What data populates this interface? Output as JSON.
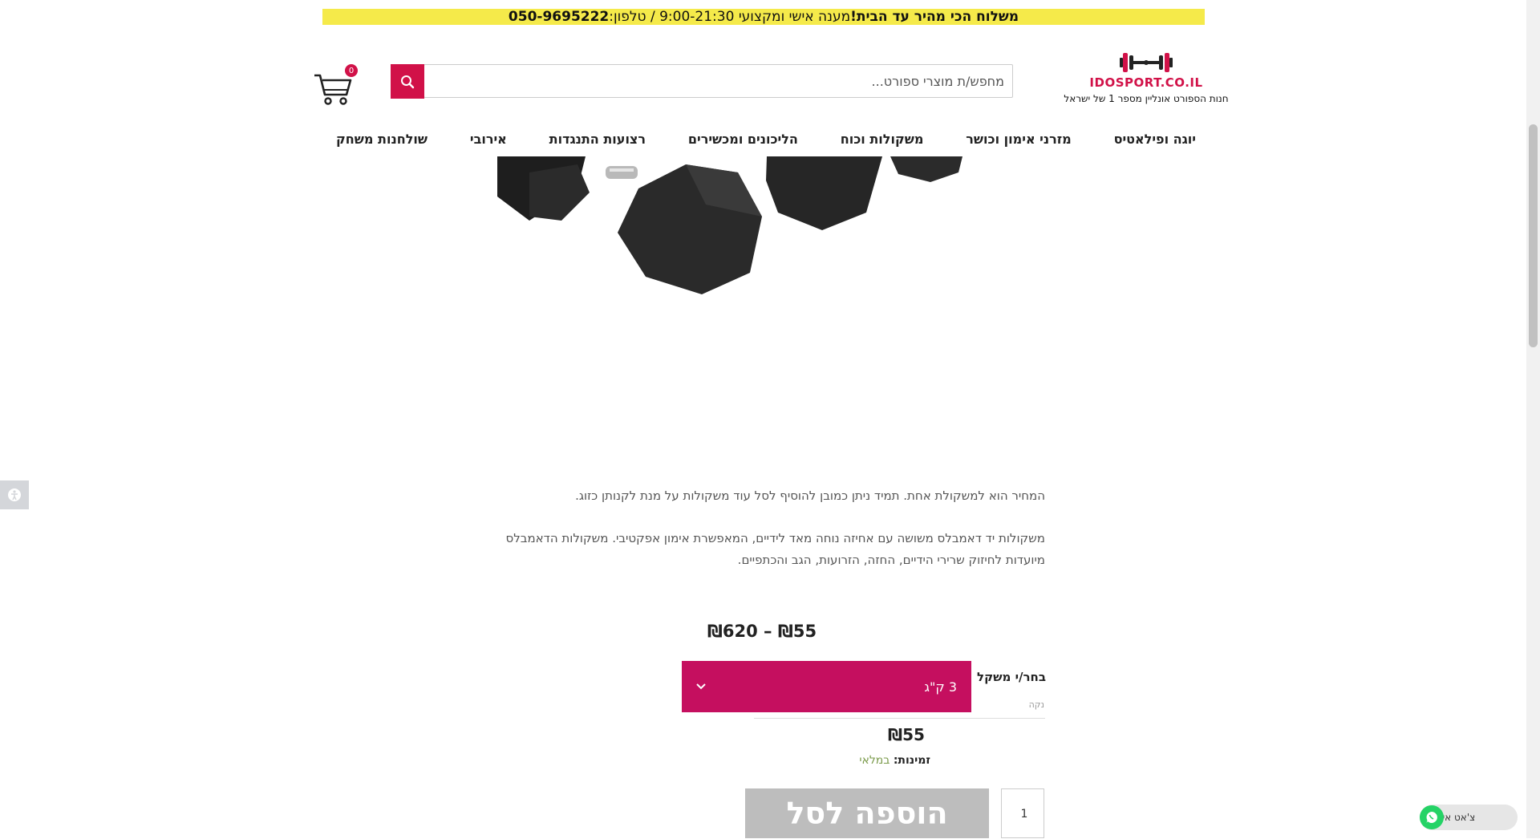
{
  "topbar": {
    "bold_text": "משלוח הכי מהיר עד הבית!",
    "service_text": " מענה אישי ומקצועי 9:00-21:30 / טלפון: ",
    "phone": "050-9695222"
  },
  "header": {
    "logo_text": "IDOSPORT.CO.IL",
    "logo_tagline": "חנות הספורט אונליין מספר 1 של ישראל",
    "search_placeholder": "מחפש/ת מוצרי ספורט...",
    "cart_count": "0"
  },
  "nav": {
    "items": [
      {
        "label": "יוגה ופילאטיס"
      },
      {
        "label": "מזרני אימון וכושר"
      },
      {
        "label": "משקולות וכוח"
      },
      {
        "label": "הליכונים ומכשירים"
      },
      {
        "label": "רצועות התנגדות"
      },
      {
        "label": "אירובי"
      },
      {
        "label": "שולחנות משחק"
      }
    ]
  },
  "product": {
    "note": "המחיר הוא למשקולת אחת. תמיד ניתן כמובן להוסיף לסל עוד משקולות על מנת לקנותן כזוג.",
    "description": "משקולות יד דאמבלס משושה עם אחיזה נוחה מאד לידיים, המאפשרת אימון אפקטיבי. משקולות הדאמבלס מיועדות לחיזוק שרירי הידיים, החזה, הזרועות, הגב והכתפיים.",
    "price_range": "₪55 – ₪620",
    "variation_label": "בחר/י משקל",
    "variation_selected": "3 ק\"ג",
    "clear_label": "נקה",
    "variant_price": "₪55",
    "availability_key": "זמינות:",
    "availability_value": " במלאי",
    "quantity": "1",
    "add_to_cart_label": "הוספה לסל"
  },
  "widgets": {
    "whatsapp_label": "צ'אט איתנו :)"
  },
  "colors": {
    "brand": "#d11148",
    "select_bg": "#c50f5f",
    "topbar_bg": "#f5ea4a",
    "whatsapp": "#25d366"
  },
  "icons": [
    "logo-dumbbell-icon",
    "search-icon",
    "cart-icon",
    "accessibility-icon",
    "whatsapp-icon",
    "chevron-down-icon"
  ]
}
